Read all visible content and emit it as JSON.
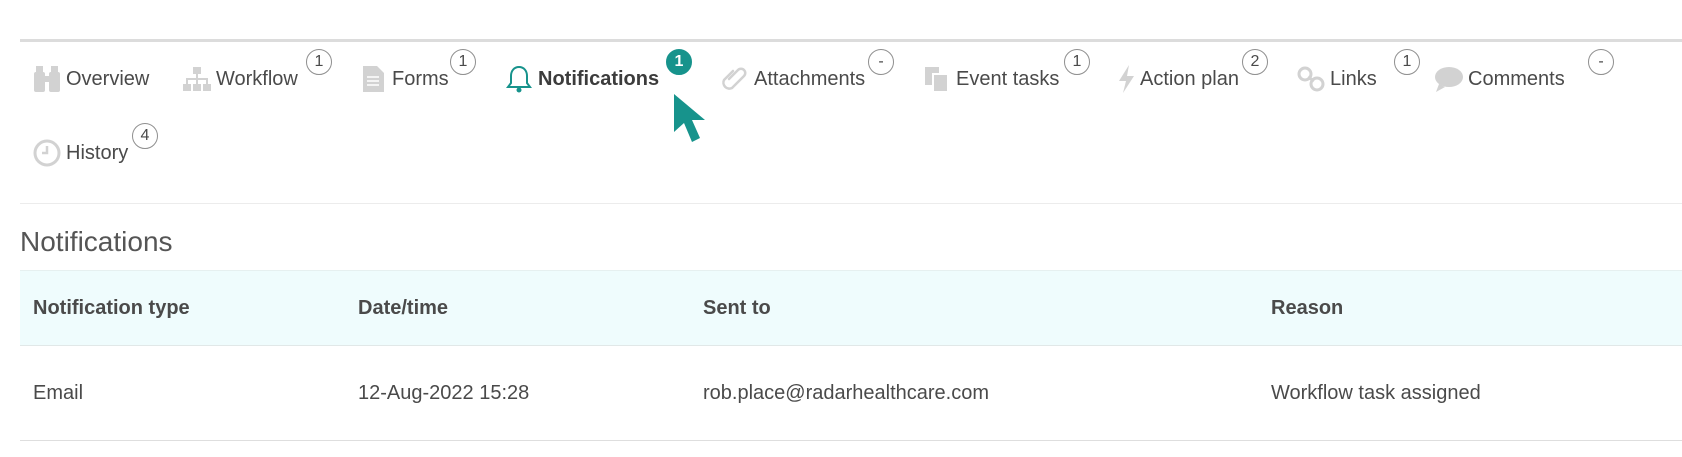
{
  "tabs": [
    {
      "label": "Overview",
      "icon": "binoculars-icon",
      "count": ""
    },
    {
      "label": "Workflow",
      "icon": "sitemap-icon",
      "count": "1"
    },
    {
      "label": "Forms",
      "icon": "document-icon",
      "count": "1"
    },
    {
      "label": "Notifications",
      "icon": "bell-icon",
      "count": "1",
      "active": true
    },
    {
      "label": "Attachments",
      "icon": "paperclip-icon",
      "count": "-"
    },
    {
      "label": "Event tasks",
      "icon": "copy-icon",
      "count": "1"
    },
    {
      "label": "Action plan",
      "icon": "bolt-icon",
      "count": "2"
    },
    {
      "label": "Links",
      "icon": "link-icon",
      "count": "1"
    },
    {
      "label": "Comments",
      "icon": "comment-icon",
      "count": "-"
    },
    {
      "label": "History",
      "icon": "clock-icon",
      "count": "4"
    }
  ],
  "section": {
    "title": "Notifications"
  },
  "table": {
    "headers": [
      "Notification type",
      "Date/time",
      "Sent to",
      "Reason"
    ],
    "rows": [
      [
        "Email",
        "12-Aug-2022 15:28",
        "rob.place@radarhealthcare.com",
        "Workflow task assigned"
      ]
    ]
  },
  "colors": {
    "accent": "#17938c",
    "header_bg": "#effcfd",
    "icon_gray": "#d2d2d2"
  }
}
